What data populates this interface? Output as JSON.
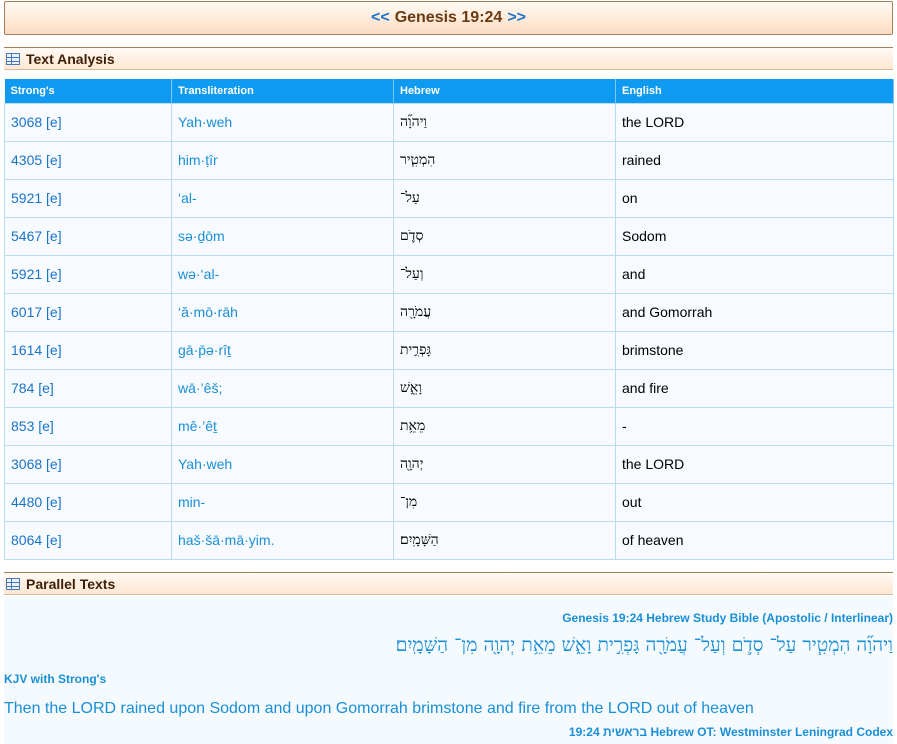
{
  "verse_nav": {
    "prev": "<<",
    "reference": "Genesis 19:24",
    "next": ">>"
  },
  "sections": {
    "text_analysis": "Text Analysis",
    "parallel_texts": "Parallel Texts"
  },
  "table": {
    "headers": {
      "strongs": "Strong's",
      "translit": "Transliteration",
      "hebrew": "Hebrew",
      "english": "English"
    },
    "rows": [
      {
        "strongs": "3068 [e]",
        "translit": "Yah·weh",
        "hebrew": "וַיהוָ֞ה",
        "english": "the LORD"
      },
      {
        "strongs": "4305 [e]",
        "translit": "him·ṭîr",
        "hebrew": "הִמְטִ֧יר",
        "english": "rained"
      },
      {
        "strongs": "5921 [e]",
        "translit": "‘al-",
        "hebrew": "עַל־",
        "english": "on"
      },
      {
        "strongs": "5467 [e]",
        "translit": "sə·ḏōm",
        "hebrew": "סְדֹ֛ם",
        "english": "Sodom"
      },
      {
        "strongs": "5921 [e]",
        "translit": "wə·‘al-",
        "hebrew": "וְעַל־",
        "english": "and"
      },
      {
        "strongs": "6017 [e]",
        "translit": "‘ă·mō·rāh",
        "hebrew": "עֲמֹרָ֖ה",
        "english": "and Gomorrah"
      },
      {
        "strongs": "1614 [e]",
        "translit": "gā·p̄ə·rîṯ",
        "hebrew": "גָּפְרִ֣ית",
        "english": "brimstone"
      },
      {
        "strongs": "784 [e]",
        "translit": "wā·’êš;",
        "hebrew": "וָאֵ֑שׁ",
        "english": "and fire"
      },
      {
        "strongs": "853 [e]",
        "translit": "mê·’êṯ",
        "hebrew": "מֵאֵ֥ת",
        "english": "-"
      },
      {
        "strongs": "3068 [e]",
        "translit": "Yah·weh",
        "hebrew": "יְהוָ֖ה",
        "english": "the LORD"
      },
      {
        "strongs": "4480 [e]",
        "translit": "min-",
        "hebrew": "מִן־",
        "english": "out"
      },
      {
        "strongs": "8064 [e]",
        "translit": "haš·šā·mā·yim.",
        "hebrew": "הַשָּׁמָֽיִם׃",
        "english": "of heaven"
      }
    ]
  },
  "parallel": {
    "heb_study_title_prefix": "Genesis 19:24 Hebrew Study Bible (",
    "apostolic": "Apostolic",
    "slash": " / ",
    "interlinear": "Interlinear",
    "heb_study_title_suffix": ")",
    "hebrew_verse": "וַיהוָ֞ה הִמְטִ֧יר עַל־ סְדֹ֛ם וְעַל־ עֲמֹרָ֖ה גָּפְרִ֣ית וָאֵ֑שׁ מֵאֵ֥ת יְהוָ֖ה מִן־ הַשָּׁמָֽיִם׃",
    "kjv_label": "KJV with Strong's",
    "kjv_verse": "Then the LORD rained upon Sodom and upon Gomorrah brimstone and fire from the LORD out of heaven",
    "wlc_label_hebrew": "בראשית 19:24",
    "wlc_label_rest": "Hebrew OT: Westminster Leningrad Codex"
  }
}
